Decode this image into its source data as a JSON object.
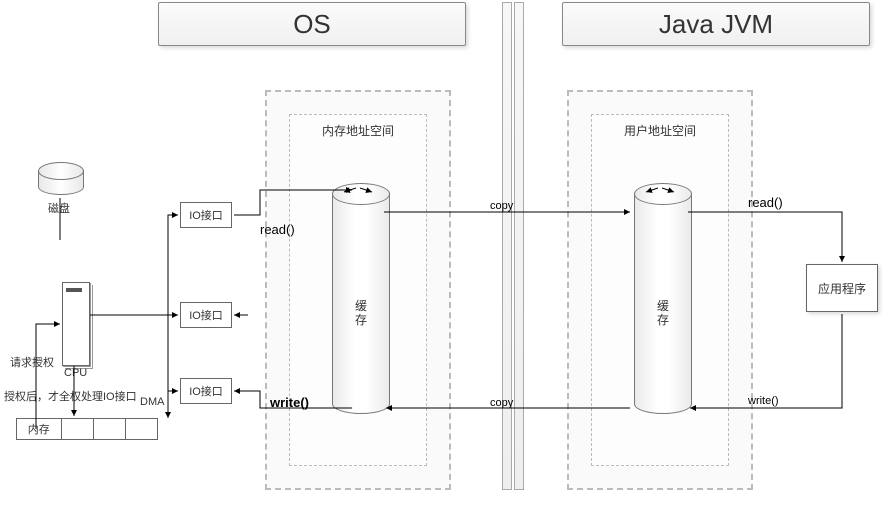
{
  "titles": {
    "os": "OS",
    "jvm": "Java JVM"
  },
  "hardware": {
    "disk": "磁盘",
    "cpu": "CPU",
    "memory": "内存",
    "io_port": "IO接口",
    "dma": "DMA"
  },
  "text": {
    "request_auth": "请求授权",
    "after_auth": "授权后，才全权处理IO接口"
  },
  "os_region": {
    "sublabel": "内存地址空间",
    "buffer": "缓\n存"
  },
  "jvm_region": {
    "sublabel": "用户地址空间",
    "buffer": "缓\n存"
  },
  "app_box": "应用程序",
  "ops": {
    "read": "read()",
    "write": "write()",
    "copy": "copy"
  },
  "chart_data": {
    "type": "diagram",
    "nodes": [
      {
        "id": "disk",
        "label": "磁盘"
      },
      {
        "id": "cpu",
        "label": "CPU"
      },
      {
        "id": "memory",
        "label": "内存"
      },
      {
        "id": "io1",
        "label": "IO接口"
      },
      {
        "id": "io2",
        "label": "IO接口"
      },
      {
        "id": "io3",
        "label": "IO接口"
      },
      {
        "id": "os_buffer",
        "label": "缓存 (内存地址空间)"
      },
      {
        "id": "jvm_buffer",
        "label": "缓存 (用户地址空间)"
      },
      {
        "id": "app",
        "label": "应用程序"
      },
      {
        "id": "os_title",
        "label": "OS"
      },
      {
        "id": "jvm_title",
        "label": "Java JVM"
      }
    ],
    "edges": [
      {
        "from": "disk",
        "to": "io1",
        "label": ""
      },
      {
        "from": "memory",
        "to": "cpu",
        "label": "请求授权",
        "dir": "both"
      },
      {
        "from": "cpu",
        "to": "io2",
        "label": "授权后，才全权处理IO接口",
        "dir": "both"
      },
      {
        "from": "memory",
        "to": "io3",
        "label": "DMA",
        "dir": "both"
      },
      {
        "from": "io1",
        "to": "os_buffer",
        "label": "read()"
      },
      {
        "from": "os_buffer",
        "to": "jvm_buffer",
        "label": "copy"
      },
      {
        "from": "jvm_buffer",
        "to": "app",
        "label": "read()"
      },
      {
        "from": "app",
        "to": "jvm_buffer",
        "label": "write()"
      },
      {
        "from": "jvm_buffer",
        "to": "os_buffer",
        "label": "copy"
      },
      {
        "from": "os_buffer",
        "to": "io3",
        "label": "write()"
      }
    ]
  }
}
